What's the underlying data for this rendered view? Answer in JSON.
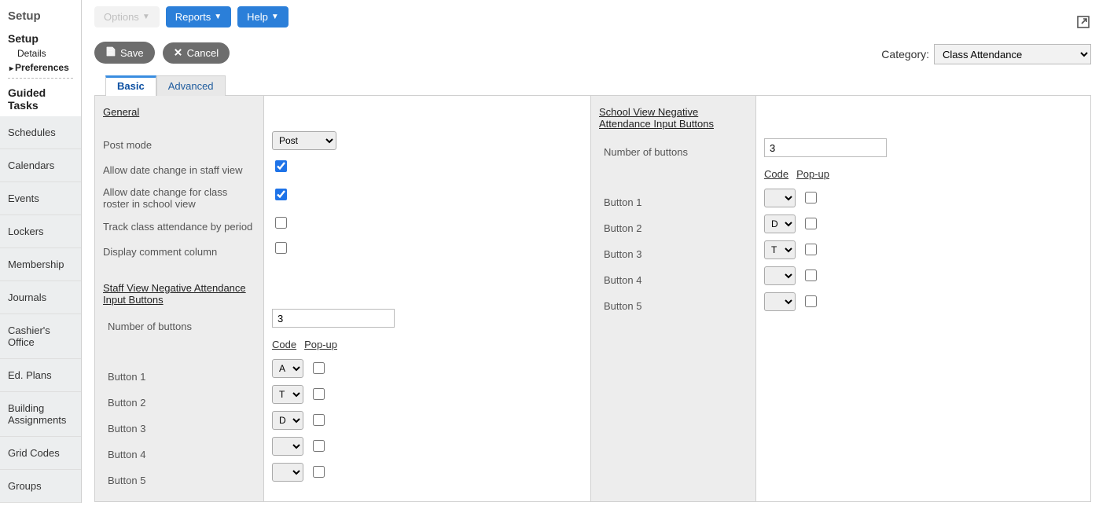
{
  "sidebar": {
    "title": "Setup",
    "setup_header": "Setup",
    "details_label": "Details",
    "preferences_label": "Preferences",
    "guided_header": "Guided Tasks",
    "items": [
      "Schedules",
      "Calendars",
      "Events",
      "Lockers",
      "Membership",
      "Journals",
      "Cashier's Office",
      "Ed. Plans",
      "Building Assignments",
      "Grid Codes",
      "Groups"
    ]
  },
  "toolbar": {
    "options_label": "Options",
    "reports_label": "Reports",
    "help_label": "Help"
  },
  "actions": {
    "save_label": "Save",
    "cancel_label": "Cancel"
  },
  "category": {
    "label": "Category:",
    "value": "Class Attendance"
  },
  "tabs": {
    "basic": "Basic",
    "advanced": "Advanced"
  },
  "left_panel": {
    "general_header": "General",
    "post_mode_label": "Post mode",
    "post_mode_value": "Post",
    "allow_date_staff_label": "Allow date change in staff view",
    "allow_date_roster_label": "Allow date change for class roster in school view",
    "track_period_label": "Track class attendance by period",
    "display_comment_label": "Display comment column",
    "staff_header": "Staff View Negative Attendance Input Buttons",
    "num_buttons_label": "Number of buttons",
    "num_buttons_value": "3",
    "code_header": "Code",
    "popup_header": "Pop-up",
    "buttons": [
      {
        "label": "Button 1",
        "code": "A"
      },
      {
        "label": "Button 2",
        "code": "T"
      },
      {
        "label": "Button 3",
        "code": "D"
      },
      {
        "label": "Button 4",
        "code": ""
      },
      {
        "label": "Button 5",
        "code": ""
      }
    ]
  },
  "right_panel": {
    "school_header": "School View Negative Attendance Input Buttons",
    "num_buttons_label": "Number of buttons",
    "num_buttons_value": "3",
    "code_header": "Code",
    "popup_header": "Pop-up",
    "buttons": [
      {
        "label": "Button 1",
        "code": ""
      },
      {
        "label": "Button 2",
        "code": "D"
      },
      {
        "label": "Button 3",
        "code": "T"
      },
      {
        "label": "Button 4",
        "code": ""
      },
      {
        "label": "Button 5",
        "code": ""
      }
    ]
  }
}
